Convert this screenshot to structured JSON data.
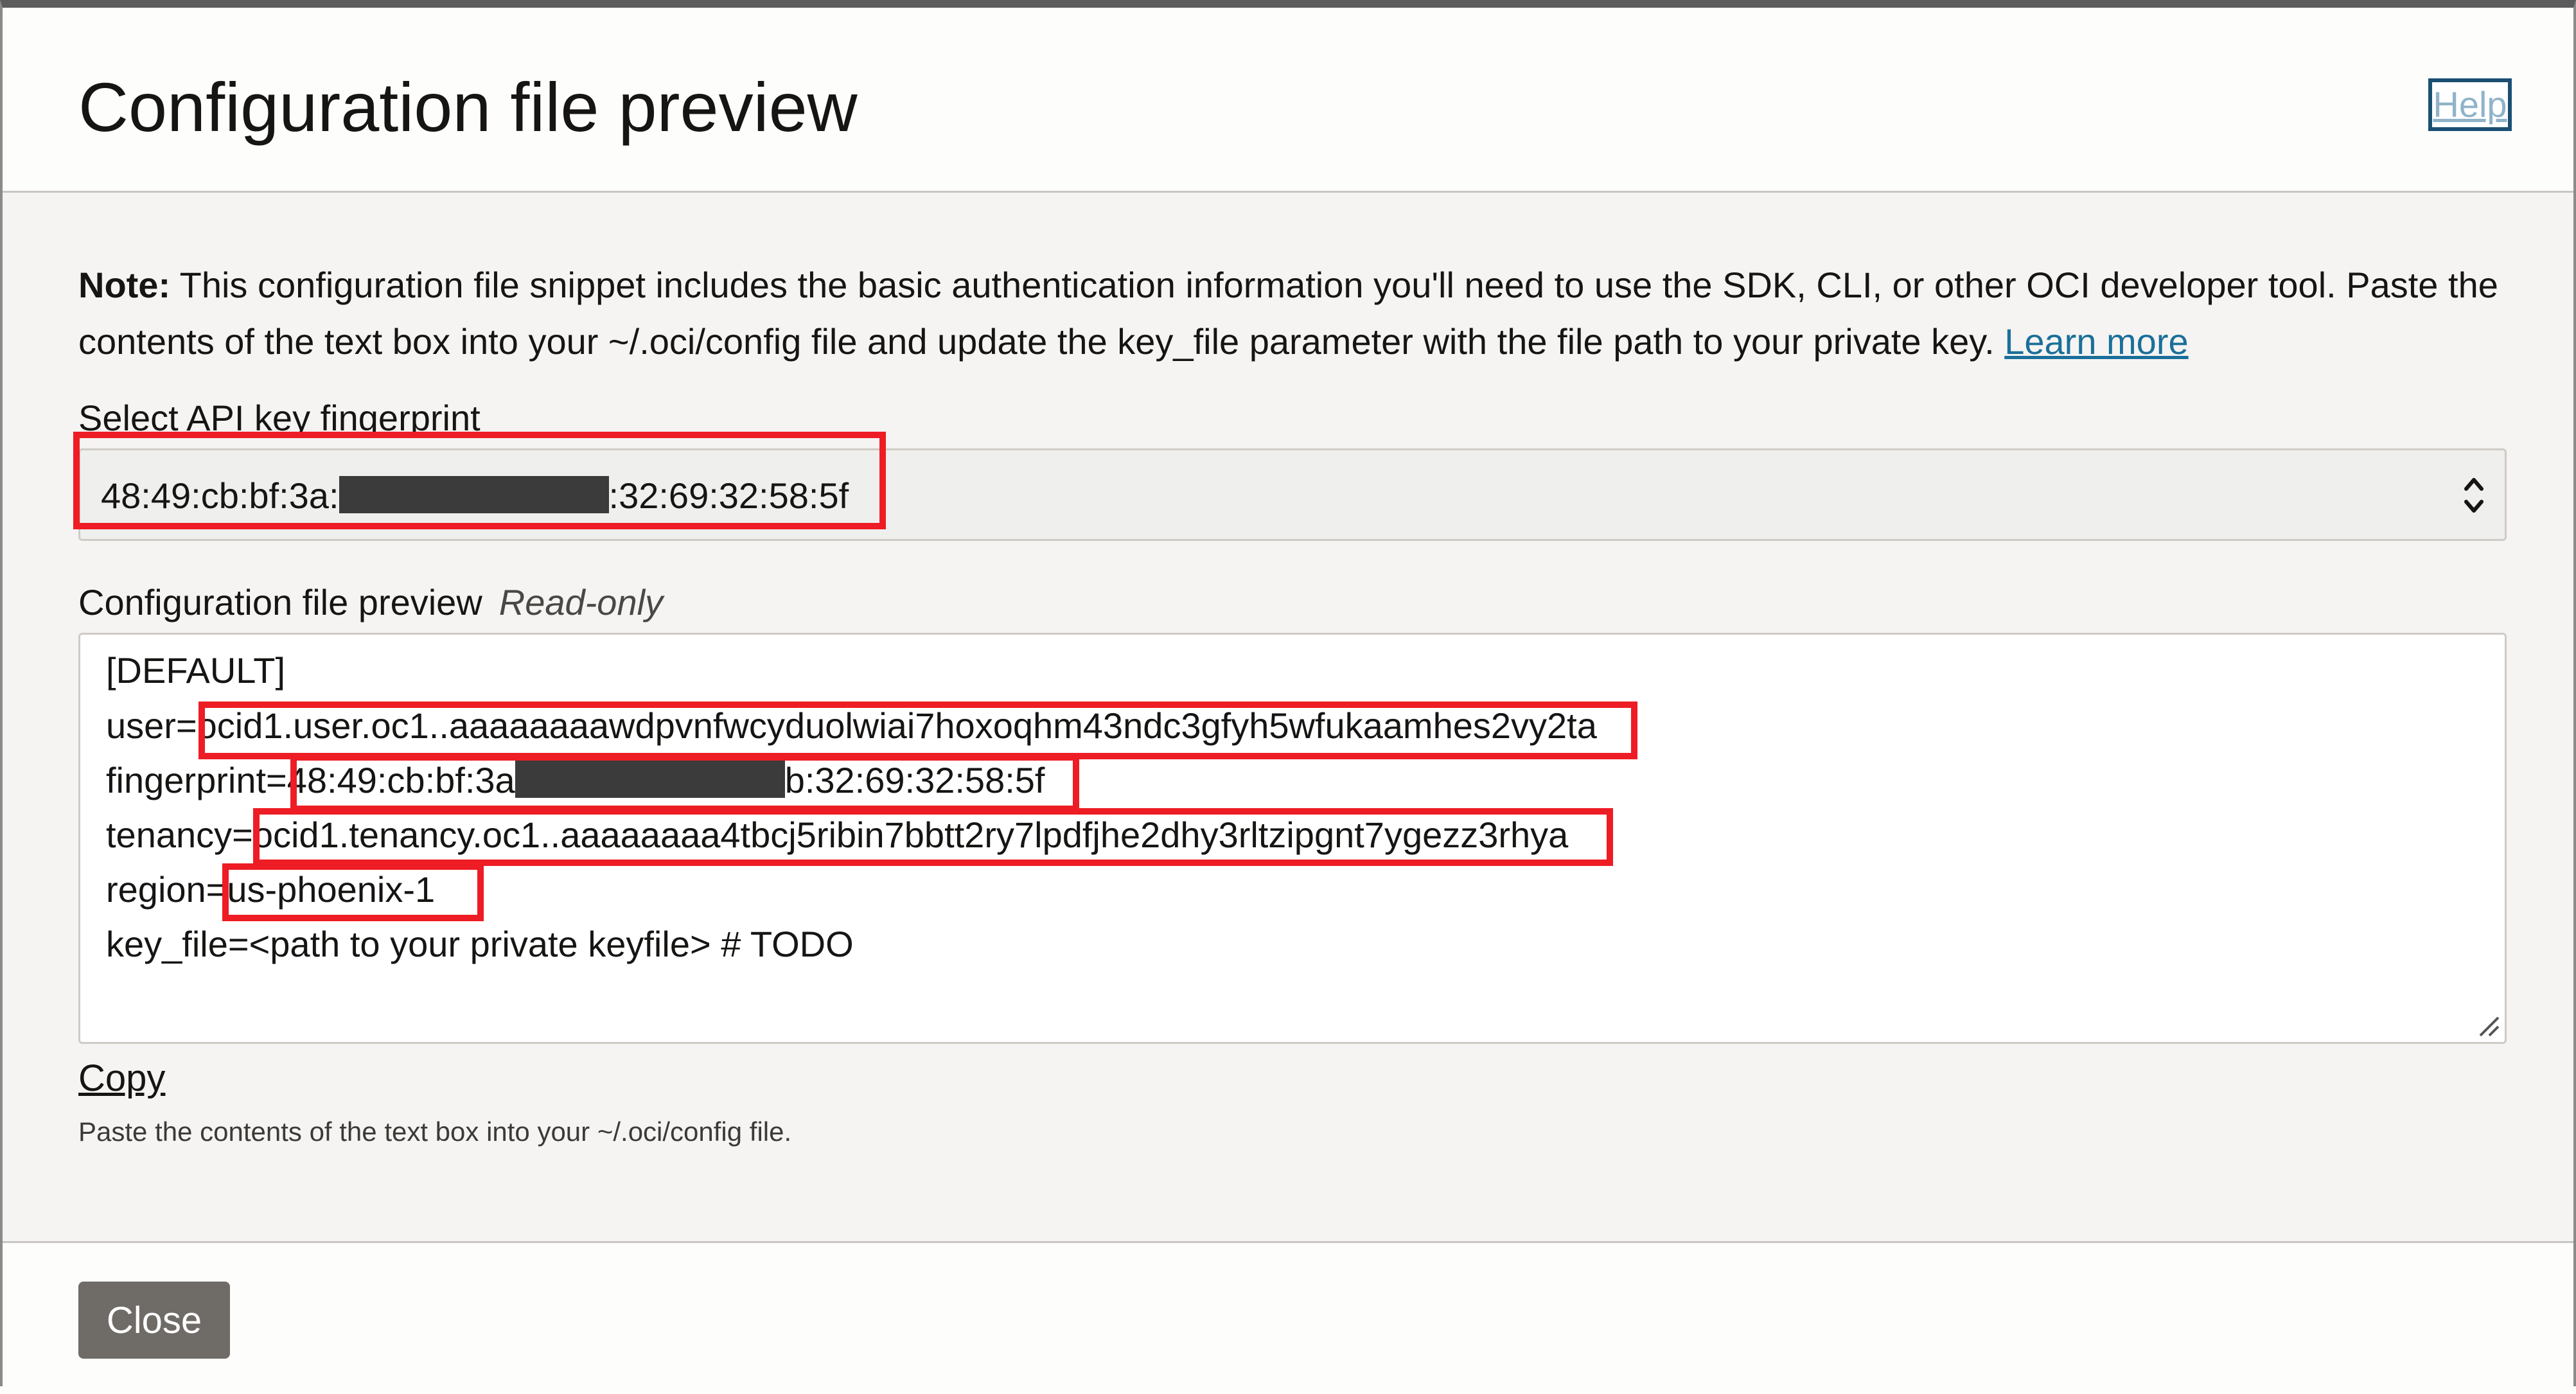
{
  "dialog": {
    "title": "Configuration file preview",
    "help_label": "Help"
  },
  "note": {
    "bold": "Note:",
    "text": " This configuration file snippet includes the basic authentication information you'll need to use the SDK, CLI, or other OCI developer tool. Paste the contents of the text box into your ~/.oci/config file and update the key_file parameter with the file path to your private key. ",
    "link": "Learn more"
  },
  "fingerprint_select": {
    "label": "Select API key fingerprint",
    "value_prefix": "48:49:cb:bf:3a:",
    "value_suffix": ":32:69:32:58:5f"
  },
  "config_preview": {
    "label": "Configuration file preview",
    "readonly_label": "Read-only",
    "lines": {
      "section": "[DEFAULT]",
      "user_key": "user=",
      "user_value": "ocid1.user.oc1..aaaaaaaawdpvnfwcyduolwiai7hoxoqhm43ndc3gfyh5wfukaamhes2vy2ta",
      "fingerprint_key": "fingerprint=",
      "fingerprint_prefix": "48:49:cb:bf:3a",
      "fingerprint_suffix": "b:32:69:32:58:5f",
      "tenancy_key": "tenancy=",
      "tenancy_value": "ocid1.tenancy.oc1..aaaaaaaa4tbcj5ribin7bbtt2ry7lpdfjhe2dhy3rltzipgnt7ygezz3rhya",
      "region_key": "region=",
      "region_value": "us-phoenix-1",
      "key_file_line": "key_file=<path to your private keyfile> # TODO"
    }
  },
  "copy": {
    "label": "Copy",
    "helper": "Paste the contents of the text box into your ~/.oci/config file."
  },
  "footer": {
    "close_label": "Close"
  },
  "colors": {
    "highlight": "#ee1c24",
    "link": "#1a6f9a",
    "close_button": "#6f6b67"
  }
}
